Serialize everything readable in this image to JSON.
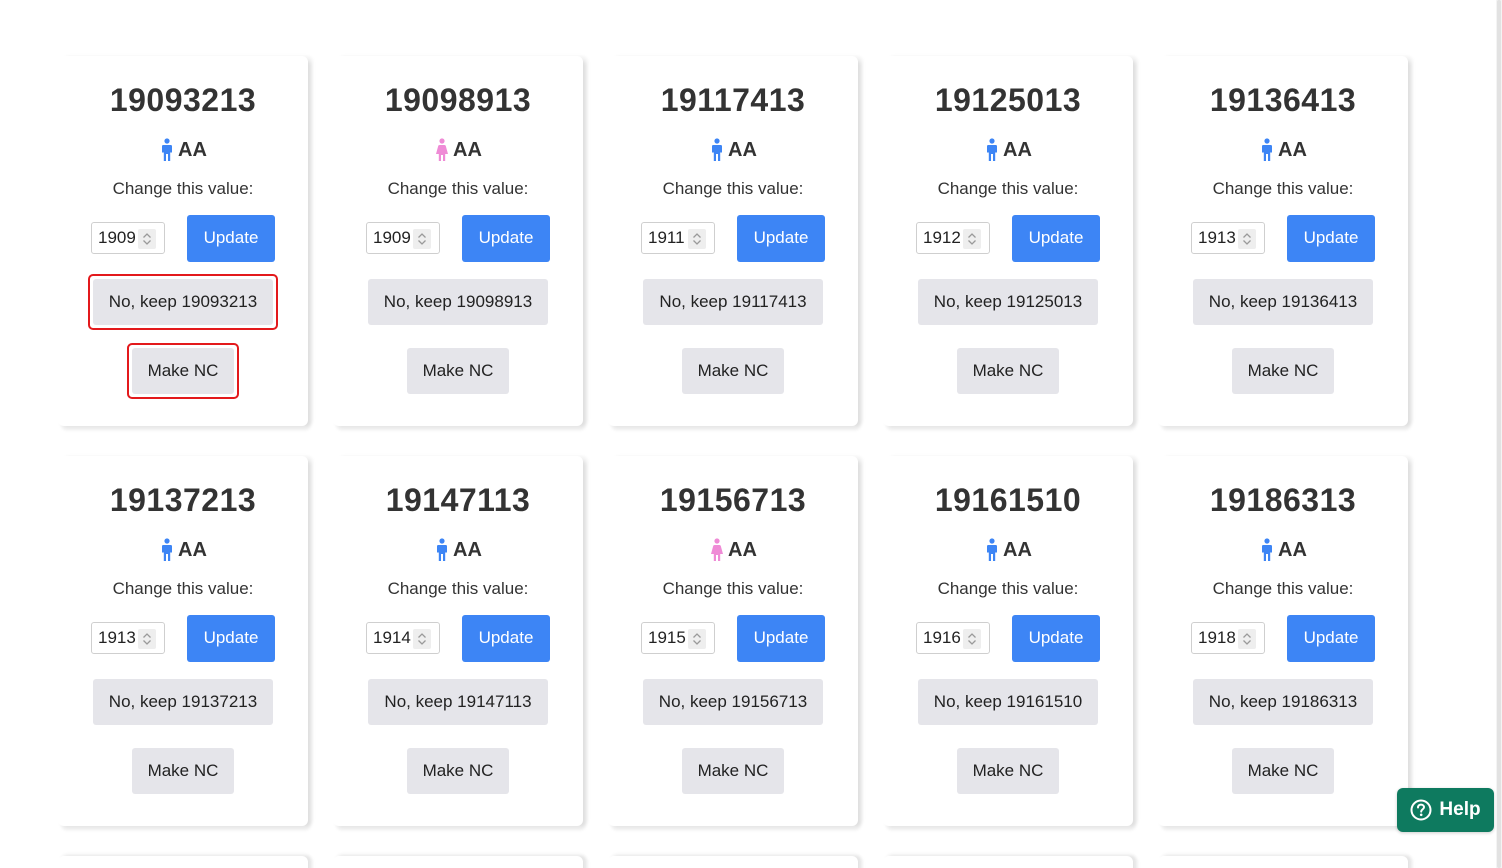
{
  "card_common": {
    "change_label": "Change this value:",
    "update_label": "Update",
    "keep_prefix": "No, keep ",
    "nc_label": "Make NC"
  },
  "colors": {
    "male_icon": "#3d85f5",
    "female_icon": "#ef8bd6",
    "primary": "#3d85f5",
    "secondary": "#e5e5ea",
    "highlight": "#e3191c",
    "help": "#0e7a5f"
  },
  "cards": [
    {
      "id": "19093213",
      "gender": "male",
      "code": "AA",
      "value": "1909",
      "keep_label": "No, keep 19093213"
    },
    {
      "id": "19098913",
      "gender": "female",
      "code": "AA",
      "value": "1909",
      "keep_label": "No, keep 19098913"
    },
    {
      "id": "19117413",
      "gender": "male",
      "code": "AA",
      "value": "1911",
      "keep_label": "No, keep 19117413"
    },
    {
      "id": "19125013",
      "gender": "male",
      "code": "AA",
      "value": "1912",
      "keep_label": "No, keep 19125013"
    },
    {
      "id": "19136413",
      "gender": "male",
      "code": "AA",
      "value": "1913",
      "keep_label": "No, keep 19136413"
    },
    {
      "id": "19137213",
      "gender": "male",
      "code": "AA",
      "value": "1913",
      "keep_label": "No, keep 19137213"
    },
    {
      "id": "19147113",
      "gender": "male",
      "code": "AA",
      "value": "1914",
      "keep_label": "No, keep 19147113"
    },
    {
      "id": "19156713",
      "gender": "female",
      "code": "AA",
      "value": "1915",
      "keep_label": "No, keep 19156713"
    },
    {
      "id": "19161510",
      "gender": "male",
      "code": "AA",
      "value": "1916",
      "keep_label": "No, keep 19161510"
    },
    {
      "id": "19186313",
      "gender": "male",
      "code": "AA",
      "value": "1918",
      "keep_label": "No, keep 19186313"
    }
  ],
  "highlighted_card_index": 0,
  "help": {
    "label": "Help",
    "icon": "question-circle-icon"
  }
}
